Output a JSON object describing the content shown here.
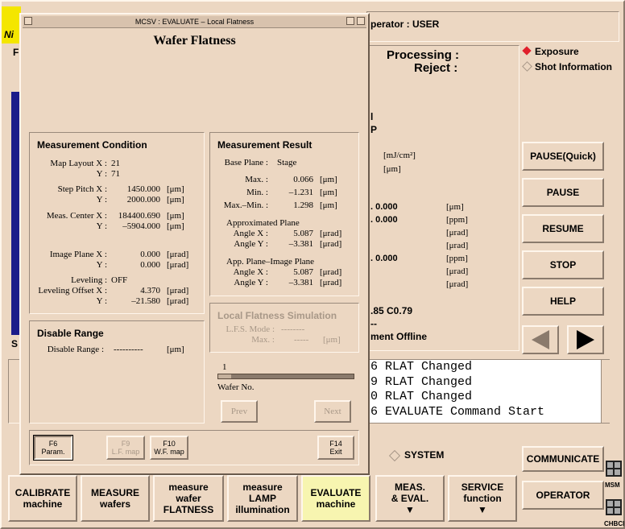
{
  "background": {
    "logo_text": "Ni",
    "operator_label": "perator : USER",
    "processing_label": "Processing :",
    "reject_label": "Reject :",
    "radio_exposure": "Exposure",
    "radio_shot_info": "Shot Information",
    "frag_l": "l",
    "frag_p": "P",
    "unit_mj": "[mJ/cm²]",
    "unit_um": "[μm]",
    "val_rows": [
      {
        "val": ". 0.000",
        "unit": "[μm]"
      },
      {
        "val": ". 0.000",
        "unit": "[ppm]"
      },
      {
        "val": "",
        "unit": "[μrad]"
      },
      {
        "val": "",
        "unit": "[μrad]"
      },
      {
        "val": ". 0.000",
        "unit": "[ppm]"
      },
      {
        "val": "",
        "unit": "[μrad]"
      },
      {
        "val": "",
        "unit": "[μrad]"
      }
    ],
    "frag_c": ".85 C0.79",
    "frag_dash": "--",
    "frag_offline": "ment Offline",
    "left_letter_f": "F",
    "left_letter_s": "S",
    "side_buttons": [
      "PAUSE(Quick)",
      "PAUSE",
      "RESUME",
      "STOP",
      "HELP"
    ],
    "messages": [
      "6 RLAT Changed",
      "9 RLAT Changed",
      "0 RLAT Changed",
      "6 EVALUATE Command Start"
    ],
    "system_label": "SYSTEM",
    "communicate": "COMMUNICATE",
    "operator_btn": "OPERATOR",
    "msm": "MSM",
    "chbci": "CHBCI",
    "bottom_buttons": [
      {
        "line1": "CALIBRATE",
        "line2": "machine",
        "line3": ""
      },
      {
        "line1": "MEASURE",
        "line2": "wafers",
        "line3": ""
      },
      {
        "line1": "measure",
        "line2": "wafer",
        "line3": "FLATNESS"
      },
      {
        "line1": "measure",
        "line2": "LAMP",
        "line3": "illumination"
      },
      {
        "line1": "EVALUATE",
        "line2": "machine",
        "line3": ""
      },
      {
        "line1": "MEAS.",
        "line2": "& EVAL.",
        "line3": "▼"
      },
      {
        "line1": "SERVICE",
        "line2": "function",
        "line3": "▼"
      }
    ]
  },
  "dialog": {
    "window_title": "MCSV : EVALUATE – Local Flatness",
    "heading": "Wafer Flatness",
    "measurement_condition": {
      "title": "Measurement Condition",
      "map_layout_x_label": "Map Layout X :",
      "map_layout_x": "21",
      "map_layout_y_label": "Y :",
      "map_layout_y": "71",
      "step_pitch_x_label": "Step Pitch X :",
      "step_pitch_x": "1450.000",
      "step_pitch_y_label": "Y :",
      "step_pitch_y": "2000.000",
      "meas_center_x_label": "Meas. Center X :",
      "meas_center_x": "184400.690",
      "meas_center_y_label": "Y :",
      "meas_center_y": "–5904.000",
      "image_plane_x_label": "Image Plane X :",
      "image_plane_x": "0.000",
      "image_plane_y_label": "Y :",
      "image_plane_y": "0.000",
      "leveling_label": "Leveling :",
      "leveling": "OFF",
      "leveling_offset_x_label": "Leveling Offset X :",
      "leveling_offset_x": "4.370",
      "leveling_offset_y_label": "Y :",
      "leveling_offset_y": "–21.580",
      "unit_um": "[μm]",
      "unit_urad": "[μrad]"
    },
    "disable_range": {
      "title": "Disable Range",
      "label": "Disable Range :",
      "value": "----------",
      "unit": "[μm]"
    },
    "measurement_result": {
      "title": "Measurement Result",
      "base_plane_label": "Base Plane :",
      "base_plane": "Stage",
      "max_label": "Max. :",
      "max": "0.066",
      "min_label": "Min. :",
      "min": "–1.231",
      "maxmin_label": "Max.–Min. :",
      "maxmin": "1.298",
      "approx_plane_label": "Approximated Plane",
      "approx_angle_x_label": "Angle X :",
      "approx_angle_x": "5.087",
      "approx_angle_y_label": "Angle Y :",
      "approx_angle_y": "–3.381",
      "app_image_label": "App. Plane–Image Plane",
      "app_angle_x_label": "Angle X :",
      "app_angle_x": "5.087",
      "app_angle_y_label": "Angle Y :",
      "app_angle_y": "–3.381",
      "unit_um": "[μm]",
      "unit_urad": "[μrad]"
    },
    "lfs": {
      "title": "Local Flatness Simulation",
      "mode_label": "L.F.S. Mode :",
      "mode": "--------",
      "max_label": "Max. :",
      "max": "-----",
      "unit": "[μm]"
    },
    "wafer_slider": {
      "value": "1",
      "label": "Wafer No.",
      "level": 0.0
    },
    "prev": "Prev",
    "next": "Next",
    "fkeys": [
      {
        "key": "F6",
        "label": "Param."
      },
      {
        "key": "F9",
        "label": "L.F. map"
      },
      {
        "key": "F10",
        "label": "W.F. map"
      },
      {
        "key": "F14",
        "label": "Exit"
      }
    ]
  }
}
